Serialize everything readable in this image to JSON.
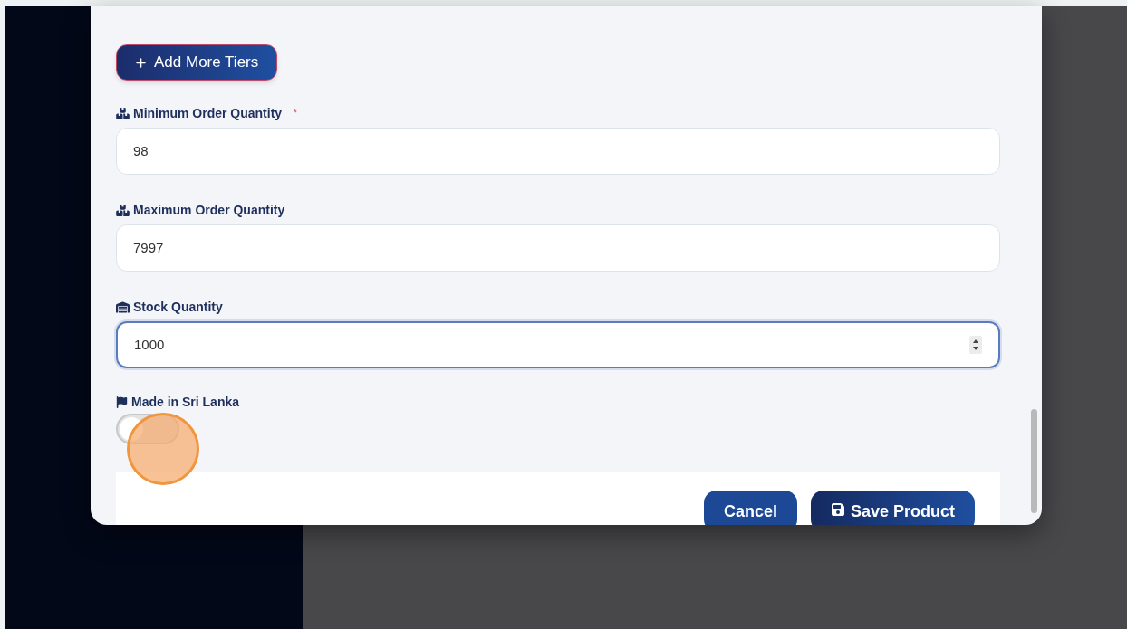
{
  "add_tiers_button": {
    "label": "Add More Tiers"
  },
  "fields": [
    {
      "kind": "text",
      "label": "Minimum Order Quantity",
      "required_mark": "*",
      "value": "98",
      "focused": false
    },
    {
      "kind": "text",
      "label": "Maximum Order Quantity",
      "value": "7997",
      "focused": false
    },
    {
      "kind": "number",
      "label": "Stock Quantity",
      "value": "1000",
      "focused": true
    }
  ],
  "toggle": {
    "label": "Made in Sri Lanka",
    "on": false
  },
  "footer_buttons": [
    {
      "kind": "secondary",
      "label": "Cancel"
    },
    {
      "kind": "primary",
      "label": "Save Product"
    }
  ]
}
